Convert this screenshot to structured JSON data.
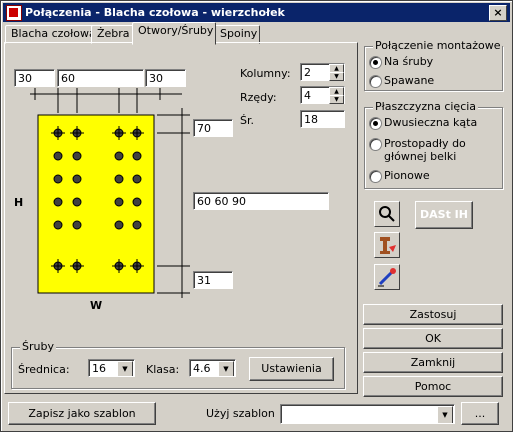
{
  "window": {
    "title": "Połączenia - Blacha czołowa - wierzchołek",
    "close": "×"
  },
  "tabs": [
    {
      "label": "Blacha czołowa"
    },
    {
      "label": "Żebra"
    },
    {
      "label": "Otwory/Śruby"
    },
    {
      "label": "Spoiny"
    }
  ],
  "spacing": {
    "left": "30",
    "middle": "60",
    "right": "30",
    "top": "70",
    "mid": "60 60 90",
    "bottom": "31"
  },
  "dims": {
    "h": "H",
    "w": "W"
  },
  "kolumny": {
    "label": "Kolumny:",
    "value": "2"
  },
  "rzedy": {
    "label": "Rzędy:",
    "value": "4"
  },
  "sr": {
    "label": "Śr.",
    "value": "18"
  },
  "bolts": {
    "title": "Śruby",
    "diameter_label": "Średnica:",
    "diameter": "16",
    "class_label": "Klasa:",
    "class": "4.6",
    "settings": "Ustawienia"
  },
  "mounting": {
    "title": "Połączenie montażowe",
    "options": [
      "Na śruby",
      "Spawane"
    ],
    "selected": 0
  },
  "cut_plane": {
    "title": "Płaszczyzna cięcia",
    "options": [
      "Dwusieczna kąta",
      "Prostopadły do głównej belki",
      "Pionowe"
    ],
    "selected": 0
  },
  "tools": {
    "dast": "DASt IH"
  },
  "actions": {
    "apply": "Zastosuj",
    "ok": "OK",
    "close": "Zamknij",
    "help": "Pomoc"
  },
  "footer": {
    "save": "Zapisz jako szablon",
    "use_label": "Użyj szablon",
    "template_value": "",
    "browse": "..."
  },
  "colors": {
    "plate": "#ffff00",
    "titlebar": "#0a246a"
  }
}
